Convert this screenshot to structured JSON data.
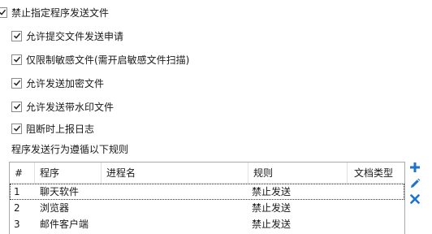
{
  "options": {
    "block_specified": "禁止指定程序发送文件",
    "allow_request": "允许提交文件发送申请",
    "sensitive_only": "仅限制敏感文件(需开启敏感文件扫描)",
    "allow_encrypted": "允许发送加密文件",
    "allow_watermark": "允许发送带水印文件",
    "report_log": "阻断时上报日志"
  },
  "rules_label": "程序发送行为遵循以下规则",
  "table": {
    "columns": [
      "#",
      "程序",
      "进程名",
      "规则",
      "文档类型"
    ],
    "rows": [
      {
        "num": "1",
        "program": "聊天软件",
        "process": "",
        "rule": "禁止发送",
        "doctype": ""
      },
      {
        "num": "2",
        "program": "浏览器",
        "process": "",
        "rule": "禁止发送",
        "doctype": ""
      },
      {
        "num": "3",
        "program": "邮件客户端",
        "process": "",
        "rule": "禁止发送",
        "doctype": ""
      }
    ]
  },
  "icons": {
    "add": "plus-icon",
    "edit": "pencil-icon",
    "delete": "x-icon"
  },
  "colors": {
    "accent": "#1f73c9",
    "checkmark": "#222222"
  }
}
